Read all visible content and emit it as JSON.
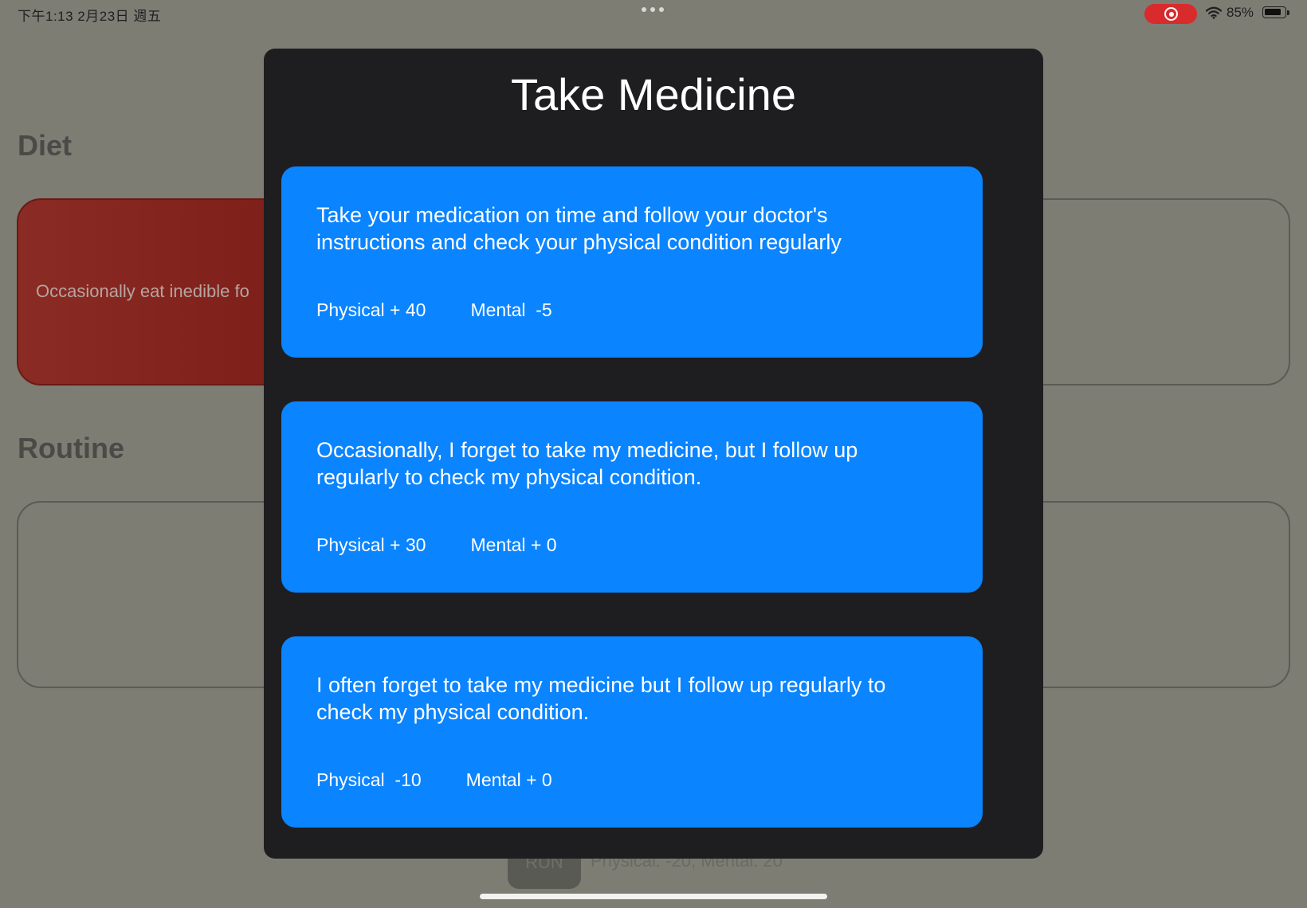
{
  "status_bar": {
    "time": "下午1:13   2月23日 週五",
    "battery": "85%",
    "battery_level": 0.85,
    "icons": [
      "screen-record-icon",
      "wifi-icon",
      "battery-icon"
    ]
  },
  "background": {
    "diet": {
      "title": "Diet",
      "card_text": "Occasionally eat inedible fo"
    },
    "routine": {
      "title": "Routine"
    },
    "run_button": "RUN",
    "run_info": "Physical: -20, Mental: 20"
  },
  "modal": {
    "title": "Take Medicine",
    "options": [
      {
        "text": "Take your medication on time and follow your doctor's instructions and check your physical condition regularly",
        "physical": "Physical + 40",
        "mental": "Mental  -5"
      },
      {
        "text": "Occasionally, I forget to take my medicine, but I follow up regularly to check my physical condition.",
        "physical": "Physical + 30",
        "mental": "Mental + 0"
      },
      {
        "text": "I often forget to take my medicine but I follow up regularly to check my physical condition.",
        "physical": "Physical  -10",
        "mental": "Mental + 0"
      }
    ]
  },
  "colors": {
    "option_card": "#0a84ff",
    "modal_background": "#1e1e21",
    "diet_card": "#8a2b24",
    "record_pill": "#d92b2b"
  }
}
